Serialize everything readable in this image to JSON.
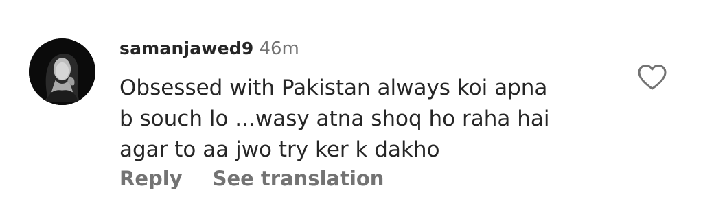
{
  "comment": {
    "username": "samanjawed9",
    "time": "46m",
    "text_lines": [
      "Obsessed with Pakistan always koi apna",
      "b souch lo ...wasy atna shoq ho raha hai",
      "agar to aa jwo try ker k dakho"
    ],
    "actions": {
      "reply": "Reply",
      "see_translation": "See translation"
    },
    "icons": {
      "like": "heart-outline-icon",
      "avatar": "profile-photo"
    },
    "colors": {
      "username": "#262626",
      "meta": "#737373",
      "body": "#262626",
      "avatar_bg": "#0a0a0a"
    }
  }
}
